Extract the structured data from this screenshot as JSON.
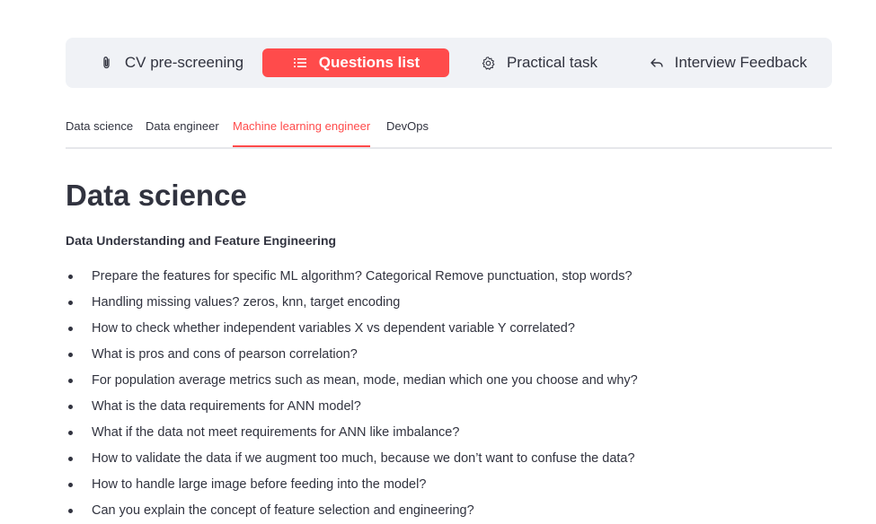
{
  "top_nav": {
    "items": [
      {
        "label": "CV pre-screening",
        "icon": "paperclip-icon",
        "active": false
      },
      {
        "label": "Questions list",
        "icon": "list-icon",
        "active": true
      },
      {
        "label": "Practical task",
        "icon": "gear-icon",
        "active": false
      },
      {
        "label": "Interview Feedback",
        "icon": "reply-arrow-icon",
        "active": false
      }
    ],
    "active_color": "#ff4b4b",
    "background": "#f0f2f6"
  },
  "tabs": {
    "items": [
      {
        "label": "Data science",
        "active": false
      },
      {
        "label": "Data engineer",
        "active": false
      },
      {
        "label": "Machine learning engineer",
        "active": true
      },
      {
        "label": "DevOps",
        "active": false
      }
    ]
  },
  "main": {
    "title": "Data science",
    "section_title": "Data Understanding and Feature Engineering",
    "questions": [
      "Prepare the features for specific ML algorithm? Categorical Remove punctuation, stop words?",
      "Handling missing values? zeros, knn, target encoding",
      "How to check whether independent variables X vs dependent variable Y correlated?",
      "What is pros and cons of pearson correlation?",
      "For population average metrics such as mean, mode, median which one you choose and why?",
      "What is the data requirements for ANN model?",
      "What if the data not meet requirements for ANN like imbalance?",
      "How to validate the data if we augment too much, because we don’t want to confuse the data?",
      "How to handle large image before feeding into the model?",
      "Can you explain the concept of feature selection and engineering?"
    ]
  }
}
